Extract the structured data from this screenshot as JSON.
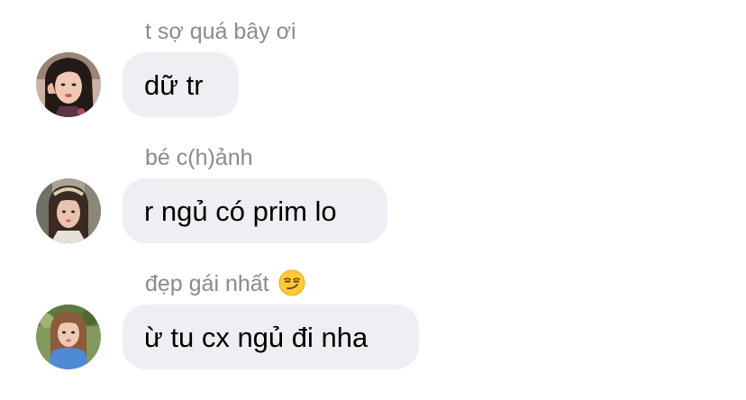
{
  "messages": [
    {
      "sender": "t sợ quá bây ơi",
      "text": "dữ tr",
      "avatar_icon": "avatar-girl-dark-hair"
    },
    {
      "sender": "bé c(h)ảnh",
      "text": "r ngủ có prim lo",
      "avatar_icon": "avatar-girl-bangs"
    },
    {
      "sender": "đẹp gái nhất",
      "sender_emoji": "smirking-face-emoji",
      "text": "ừ tu cx ngủ đi nha",
      "avatar_icon": "avatar-girl-blue-shirt"
    }
  ],
  "colors": {
    "bubble": "#efeff3",
    "sender_name": "#8a8a8e",
    "text": "#000000",
    "background": "#ffffff"
  }
}
